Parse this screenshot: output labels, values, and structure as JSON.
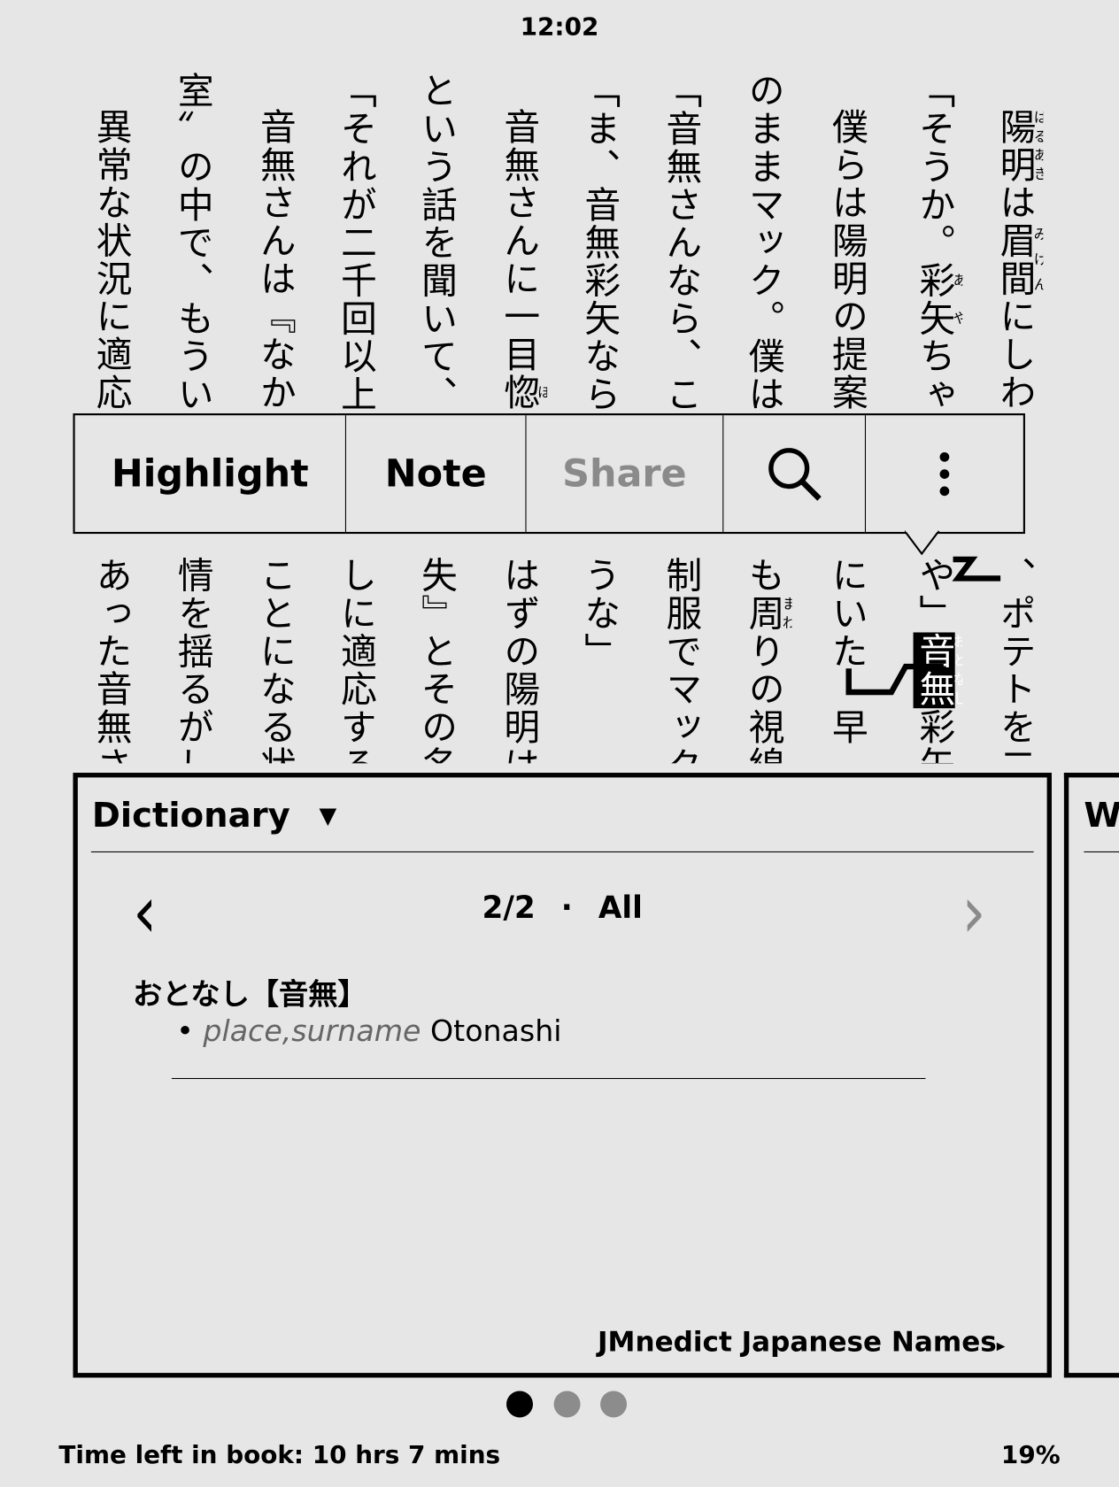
{
  "status": {
    "clock": "12:02"
  },
  "book": {
    "columns": [
      {
        "indent": true,
        "top": [
          [
            "陽明",
            "はるあき"
          ],
          [
            "は"
          ],
          [
            "眉間",
            "みけん"
          ],
          [
            "にしわ"
          ]
        ],
        "bottom": [
          [
            "、ポテトを二"
          ]
        ]
      },
      {
        "indent": false,
        "top": [
          [
            "「そうか。"
          ],
          [
            "彩矢",
            "あや"
          ],
          [
            "ちゃん"
          ]
        ],
        "bottom": [
          [
            "や」"
          ],
          [
            "音無",
            "おとなし",
            true
          ],
          [
            "彩矢は"
          ]
        ]
      },
      {
        "indent": true,
        "top": [
          [
            "僕らは陽明の提案"
          ]
        ],
        "bottom": [
          [
            "にいた　早"
          ]
        ]
      },
      {
        "indent": false,
        "top": [
          [
            "のままマック。僕は"
          ]
        ],
        "bottom": [
          [
            "も"
          ],
          [
            "周",
            "まわ"
          ],
          [
            "りの視線"
          ]
        ]
      },
      {
        "indent": false,
        "top": [
          [
            "「音無さんなら、この"
          ]
        ],
        "bottom": [
          [
            "制服でマック"
          ]
        ]
      },
      {
        "indent": false,
        "top": [
          [
            "「ま、音無彩矢ならそ"
          ]
        ],
        "bottom": [
          [
            "うな」"
          ]
        ]
      },
      {
        "indent": true,
        "top": [
          [
            "音無さんに一目"
          ],
          [
            "惚",
            "ぼ"
          ]
        ],
        "bottom": [
          [
            "はずの陽明は、"
          ]
        ]
      },
      {
        "indent": false,
        "top": [
          [
            "という話を聞いて、"
          ]
        ],
        "bottom": [
          [
            "失』とその名"
          ]
        ]
      },
      {
        "indent": false,
        "top": [
          [
            "「それが二千回以上の"
          ]
        ],
        "bottom": [
          [
            "しに適応する"
          ]
        ]
      },
      {
        "indent": true,
        "top": [
          [
            "音無さんは『なか"
          ]
        ],
        "bottom": [
          [
            "ことになる状"
          ]
        ]
      },
      {
        "indent": false,
        "top": [
          [
            "室〟の中で、もうい"
          ]
        ],
        "bottom": [
          [
            "情を揺るがし"
          ]
        ]
      },
      {
        "indent": true,
        "top": [
          [
            "異常な状況に適応"
          ]
        ],
        "bottom": [
          [
            "あった音無さ"
          ]
        ]
      }
    ]
  },
  "popup": {
    "highlight": "Highlight",
    "note": "Note",
    "share": "Share",
    "search_icon": "search-icon",
    "more_icon": "more-vertical-icon"
  },
  "dictionary": {
    "title": "Dictionary",
    "dropdown_icon": "▼",
    "prev_icon": "‹",
    "next_icon": "›",
    "page": "2/2",
    "separator": "·",
    "filter": "All",
    "headword": "おとなし【音無】",
    "bullet": "•",
    "pos": "place,surname",
    "gloss": "Otonashi",
    "source": "JMnedict Japanese Names",
    "source_arrow": "▸"
  },
  "next_panel": {
    "title_partial": "W"
  },
  "pager": {
    "count": 3,
    "active": 0
  },
  "footer": {
    "time_left": "Time left in book: 10 hrs 7 mins",
    "progress": "19%"
  },
  "colors": {
    "background": "#e6e6e6",
    "disabled": "#8a8a8a",
    "dot_inactive": "#8c8c8c"
  }
}
